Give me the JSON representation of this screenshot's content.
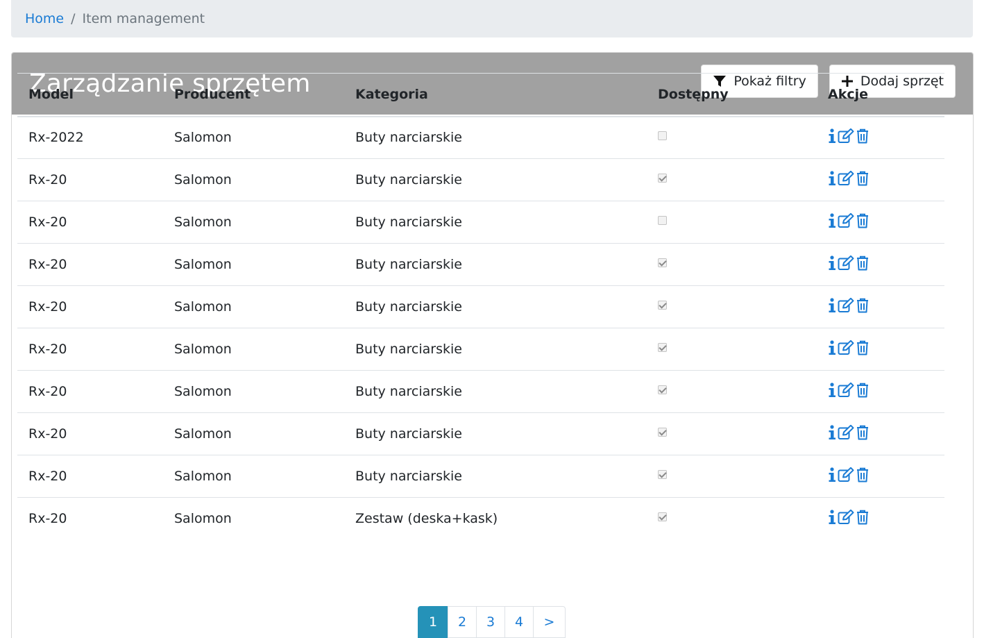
{
  "breadcrumb": {
    "home": "Home",
    "separator": "/",
    "current": "Item management"
  },
  "header": {
    "title": "Zarządzanie sprzętem",
    "filters_button": "Pokaż filtry",
    "add_button": "Dodaj sprzęt"
  },
  "table": {
    "columns": [
      "Model",
      "Producent",
      "Kategoria",
      "Dostępny",
      "Akcje"
    ],
    "rows": [
      {
        "model": "Rx-2022",
        "producer": "Salomon",
        "category": "Buty narciarskie",
        "available": false
      },
      {
        "model": "Rx-20",
        "producer": "Salomon",
        "category": "Buty narciarskie",
        "available": true
      },
      {
        "model": "Rx-20",
        "producer": "Salomon",
        "category": "Buty narciarskie",
        "available": false
      },
      {
        "model": "Rx-20",
        "producer": "Salomon",
        "category": "Buty narciarskie",
        "available": true
      },
      {
        "model": "Rx-20",
        "producer": "Salomon",
        "category": "Buty narciarskie",
        "available": true
      },
      {
        "model": "Rx-20",
        "producer": "Salomon",
        "category": "Buty narciarskie",
        "available": true
      },
      {
        "model": "Rx-20",
        "producer": "Salomon",
        "category": "Buty narciarskie",
        "available": true
      },
      {
        "model": "Rx-20",
        "producer": "Salomon",
        "category": "Buty narciarskie",
        "available": true
      },
      {
        "model": "Rx-20",
        "producer": "Salomon",
        "category": "Buty narciarskie",
        "available": true
      },
      {
        "model": "Rx-20",
        "producer": "Salomon",
        "category": "Zestaw (deska+kask)",
        "available": true
      }
    ],
    "row_actions": [
      "info-icon",
      "edit-icon",
      "trash-icon"
    ]
  },
  "pagination": {
    "pages": [
      "1",
      "2",
      "3",
      "4"
    ],
    "active": "1",
    "next": ">"
  },
  "colors": {
    "accent": "#1a7bd4",
    "header_bg": "#a1a1a1",
    "breadcrumb_bg": "#e9ecef",
    "page_active": "#2592b8"
  }
}
